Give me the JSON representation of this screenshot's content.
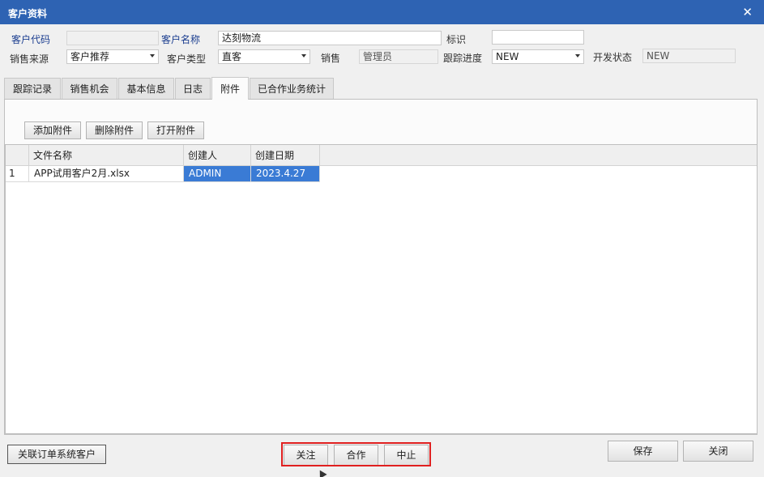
{
  "window": {
    "title": "客户资料",
    "close_glyph": "✕"
  },
  "form": {
    "customer_code": {
      "label": "客户代码",
      "value": ""
    },
    "customer_name": {
      "label": "客户名称",
      "value": "达刻物流"
    },
    "identifier": {
      "label": "标识",
      "value": ""
    },
    "sales_source": {
      "label": "销售来源",
      "value": "客户推荐"
    },
    "customer_type": {
      "label": "客户类型",
      "value": "直客"
    },
    "sales": {
      "label": "销售",
      "value": "管理员"
    },
    "tracking_progress": {
      "label": "跟踪进度",
      "value": "NEW"
    },
    "dev_status": {
      "label": "开发状态",
      "value": "NEW"
    }
  },
  "tabs": [
    {
      "label": "跟踪记录",
      "active": false
    },
    {
      "label": "销售机会",
      "active": false
    },
    {
      "label": "基本信息",
      "active": false
    },
    {
      "label": "日志",
      "active": false
    },
    {
      "label": "附件",
      "active": true
    },
    {
      "label": "已合作业务统计",
      "active": false
    }
  ],
  "attachments_toolbar": {
    "add": "添加附件",
    "delete": "删除附件",
    "open": "打开附件"
  },
  "grid": {
    "columns": [
      "文件名称",
      "创建人",
      "创建日期"
    ],
    "rows": [
      {
        "index": "1",
        "file_name": "APP试用客户2月.xlsx",
        "creator": "ADMIN",
        "created_date": "2023.4.27"
      }
    ]
  },
  "footer": {
    "link_button": "关联订单系统客户",
    "follow": "关注",
    "cooperate": "合作",
    "stop": "中止",
    "save": "保存",
    "close": "关闭"
  },
  "colors": {
    "titlebar": "#2e63b3",
    "selection": "#3a7bd5",
    "highlight": "#e02020"
  }
}
